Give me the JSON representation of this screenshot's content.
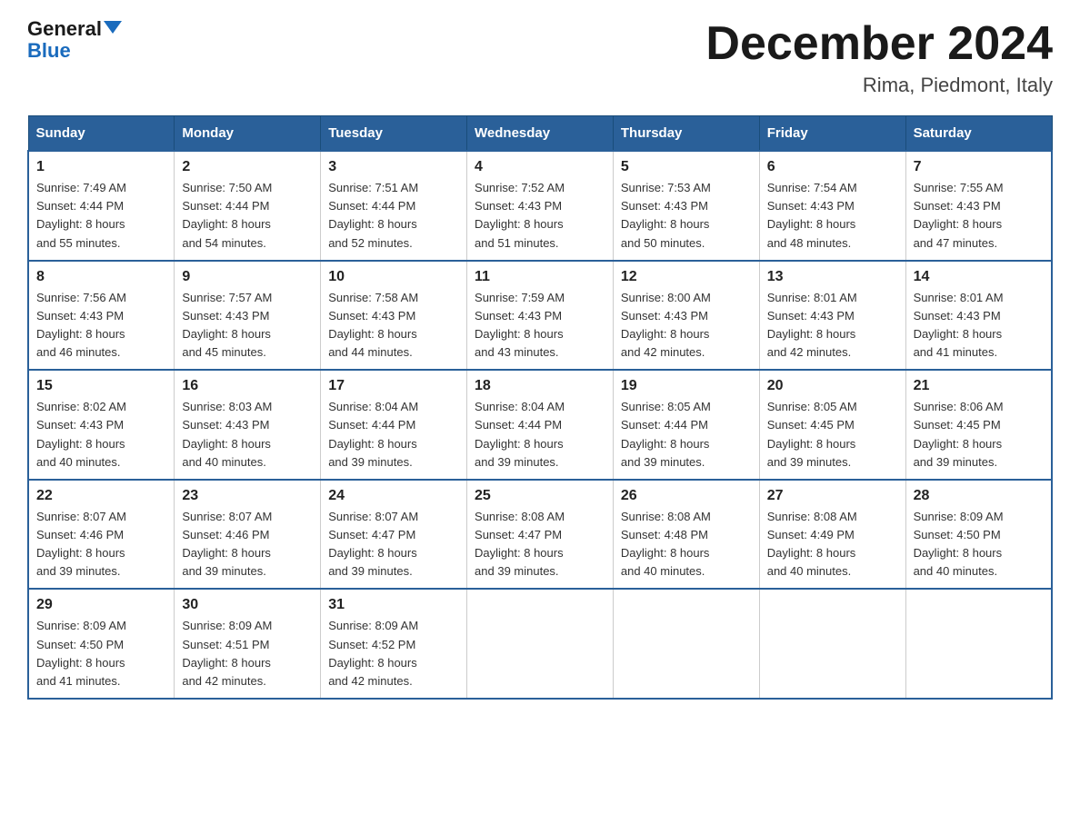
{
  "header": {
    "logo_general": "General",
    "logo_blue": "Blue",
    "title": "December 2024",
    "subtitle": "Rima, Piedmont, Italy"
  },
  "days_of_week": [
    "Sunday",
    "Monday",
    "Tuesday",
    "Wednesday",
    "Thursday",
    "Friday",
    "Saturday"
  ],
  "weeks": [
    [
      {
        "day": "1",
        "sunrise": "7:49 AM",
        "sunset": "4:44 PM",
        "daylight": "8 hours and 55 minutes."
      },
      {
        "day": "2",
        "sunrise": "7:50 AM",
        "sunset": "4:44 PM",
        "daylight": "8 hours and 54 minutes."
      },
      {
        "day": "3",
        "sunrise": "7:51 AM",
        "sunset": "4:44 PM",
        "daylight": "8 hours and 52 minutes."
      },
      {
        "day": "4",
        "sunrise": "7:52 AM",
        "sunset": "4:43 PM",
        "daylight": "8 hours and 51 minutes."
      },
      {
        "day": "5",
        "sunrise": "7:53 AM",
        "sunset": "4:43 PM",
        "daylight": "8 hours and 50 minutes."
      },
      {
        "day": "6",
        "sunrise": "7:54 AM",
        "sunset": "4:43 PM",
        "daylight": "8 hours and 48 minutes."
      },
      {
        "day": "7",
        "sunrise": "7:55 AM",
        "sunset": "4:43 PM",
        "daylight": "8 hours and 47 minutes."
      }
    ],
    [
      {
        "day": "8",
        "sunrise": "7:56 AM",
        "sunset": "4:43 PM",
        "daylight": "8 hours and 46 minutes."
      },
      {
        "day": "9",
        "sunrise": "7:57 AM",
        "sunset": "4:43 PM",
        "daylight": "8 hours and 45 minutes."
      },
      {
        "day": "10",
        "sunrise": "7:58 AM",
        "sunset": "4:43 PM",
        "daylight": "8 hours and 44 minutes."
      },
      {
        "day": "11",
        "sunrise": "7:59 AM",
        "sunset": "4:43 PM",
        "daylight": "8 hours and 43 minutes."
      },
      {
        "day": "12",
        "sunrise": "8:00 AM",
        "sunset": "4:43 PM",
        "daylight": "8 hours and 42 minutes."
      },
      {
        "day": "13",
        "sunrise": "8:01 AM",
        "sunset": "4:43 PM",
        "daylight": "8 hours and 42 minutes."
      },
      {
        "day": "14",
        "sunrise": "8:01 AM",
        "sunset": "4:43 PM",
        "daylight": "8 hours and 41 minutes."
      }
    ],
    [
      {
        "day": "15",
        "sunrise": "8:02 AM",
        "sunset": "4:43 PM",
        "daylight": "8 hours and 40 minutes."
      },
      {
        "day": "16",
        "sunrise": "8:03 AM",
        "sunset": "4:43 PM",
        "daylight": "8 hours and 40 minutes."
      },
      {
        "day": "17",
        "sunrise": "8:04 AM",
        "sunset": "4:44 PM",
        "daylight": "8 hours and 39 minutes."
      },
      {
        "day": "18",
        "sunrise": "8:04 AM",
        "sunset": "4:44 PM",
        "daylight": "8 hours and 39 minutes."
      },
      {
        "day": "19",
        "sunrise": "8:05 AM",
        "sunset": "4:44 PM",
        "daylight": "8 hours and 39 minutes."
      },
      {
        "day": "20",
        "sunrise": "8:05 AM",
        "sunset": "4:45 PM",
        "daylight": "8 hours and 39 minutes."
      },
      {
        "day": "21",
        "sunrise": "8:06 AM",
        "sunset": "4:45 PM",
        "daylight": "8 hours and 39 minutes."
      }
    ],
    [
      {
        "day": "22",
        "sunrise": "8:07 AM",
        "sunset": "4:46 PM",
        "daylight": "8 hours and 39 minutes."
      },
      {
        "day": "23",
        "sunrise": "8:07 AM",
        "sunset": "4:46 PM",
        "daylight": "8 hours and 39 minutes."
      },
      {
        "day": "24",
        "sunrise": "8:07 AM",
        "sunset": "4:47 PM",
        "daylight": "8 hours and 39 minutes."
      },
      {
        "day": "25",
        "sunrise": "8:08 AM",
        "sunset": "4:47 PM",
        "daylight": "8 hours and 39 minutes."
      },
      {
        "day": "26",
        "sunrise": "8:08 AM",
        "sunset": "4:48 PM",
        "daylight": "8 hours and 40 minutes."
      },
      {
        "day": "27",
        "sunrise": "8:08 AM",
        "sunset": "4:49 PM",
        "daylight": "8 hours and 40 minutes."
      },
      {
        "day": "28",
        "sunrise": "8:09 AM",
        "sunset": "4:50 PM",
        "daylight": "8 hours and 40 minutes."
      }
    ],
    [
      {
        "day": "29",
        "sunrise": "8:09 AM",
        "sunset": "4:50 PM",
        "daylight": "8 hours and 41 minutes."
      },
      {
        "day": "30",
        "sunrise": "8:09 AM",
        "sunset": "4:51 PM",
        "daylight": "8 hours and 42 minutes."
      },
      {
        "day": "31",
        "sunrise": "8:09 AM",
        "sunset": "4:52 PM",
        "daylight": "8 hours and 42 minutes."
      },
      null,
      null,
      null,
      null
    ]
  ],
  "labels": {
    "sunrise": "Sunrise:",
    "sunset": "Sunset:",
    "daylight": "Daylight:"
  }
}
